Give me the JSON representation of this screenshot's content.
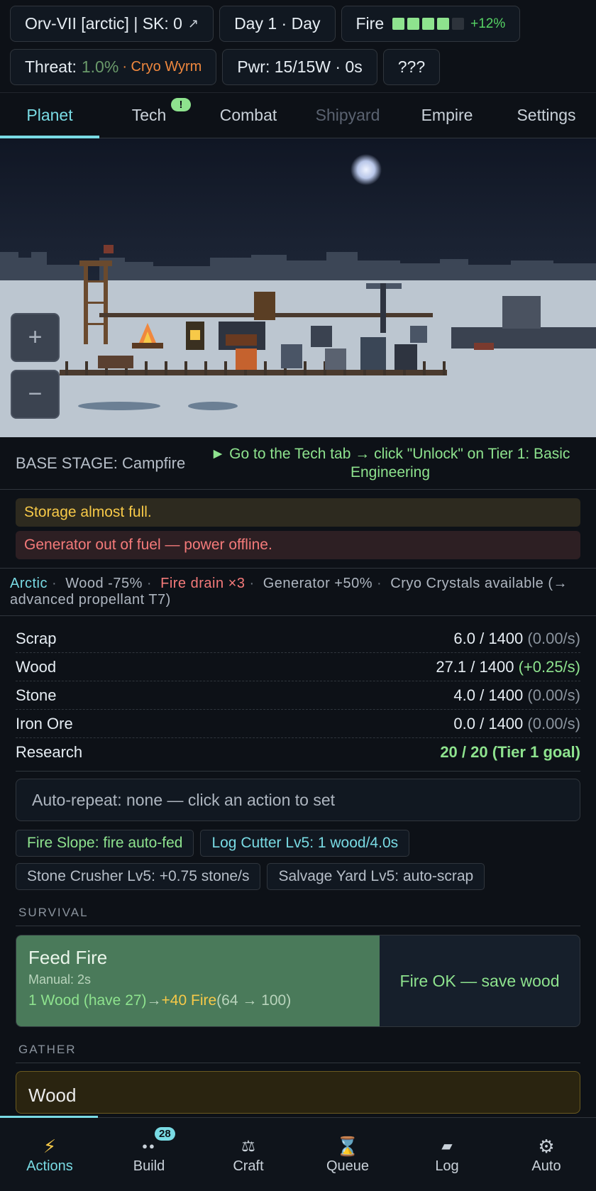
{
  "header": {
    "planet_chip": "Orv-VII [arctic] | SK: 0",
    "planet_arrow": "↗",
    "day_chip": "Day 1 · Day",
    "fire_label": "Fire",
    "fire_level": 4,
    "fire_level_max": 5,
    "fire_bonus": "+12%",
    "threat_label": "Threat:",
    "threat_value": "1.0%",
    "threat_enemy": "· Cryo Wyrm",
    "power_chip": "Pwr: 15/15W · 0s",
    "mystery_chip": "???"
  },
  "tabs": [
    {
      "label": "Planet"
    },
    {
      "label": "Tech",
      "badge": "!"
    },
    {
      "label": "Combat"
    },
    {
      "label": "Shipyard"
    },
    {
      "label": "Empire"
    },
    {
      "label": "Settings"
    }
  ],
  "scene": {
    "zoom_in": "+",
    "zoom_out": "−"
  },
  "stage": {
    "label": "BASE STAGE: Campfire",
    "hint": "► Go to the Tech tab → click \"Unlock\" on Tier 1: Basic Engineering"
  },
  "alerts": {
    "warning": "Storage almost full.",
    "error": "Generator out of fuel — power offline."
  },
  "modifiers": {
    "biome": "Arctic",
    "wood": "Wood -75%",
    "fire": "Fire drain ×3",
    "generator": "Generator +50%",
    "crystals": "Cryo Crystals available (→ advanced propellant T7)"
  },
  "resources": [
    {
      "name": "Scrap",
      "amount": "6.0 / 1400",
      "rate": "(0.00/s)"
    },
    {
      "name": "Wood",
      "amount": "27.1 / 1400",
      "rate": "(+0.25/s)"
    },
    {
      "name": "Stone",
      "amount": "4.0 / 1400",
      "rate": "(0.00/s)"
    },
    {
      "name": "Iron Ore",
      "amount": "0.0 / 1400",
      "rate": "(0.00/s)"
    },
    {
      "name": "Research",
      "goal": "20 / 20 (Tier 1 goal)"
    }
  ],
  "auto_repeat": "Auto-repeat: none — click an action to set",
  "automations": [
    "Fire Slope: fire auto-fed",
    "Log Cutter Lv5: 1 wood/4.0s",
    "Stone Crusher Lv5: +0.75 stone/s",
    "Salvage Yard Lv5: auto-scrap"
  ],
  "sections": {
    "survival": "SURVIVAL",
    "gather": "GATHER"
  },
  "feed_fire": {
    "title": "Feed Fire",
    "manual": "Manual: 2s",
    "cost": "1 Wood (have 27)",
    "arrow": "→",
    "gain": "+40 Fire",
    "range": "(64 → 100)",
    "status": "Fire OK — save wood"
  },
  "wood_card": {
    "title": "Wood"
  },
  "bottom_nav": [
    {
      "label": "Actions",
      "icon": "⚡"
    },
    {
      "label": "Build",
      "icon": "●●",
      "badge": "28"
    },
    {
      "label": "Craft",
      "icon": "⚖"
    },
    {
      "label": "Queue",
      "icon": "⌛"
    },
    {
      "label": "Log",
      "icon": "▰"
    },
    {
      "label": "Auto",
      "icon": "⚙"
    }
  ]
}
